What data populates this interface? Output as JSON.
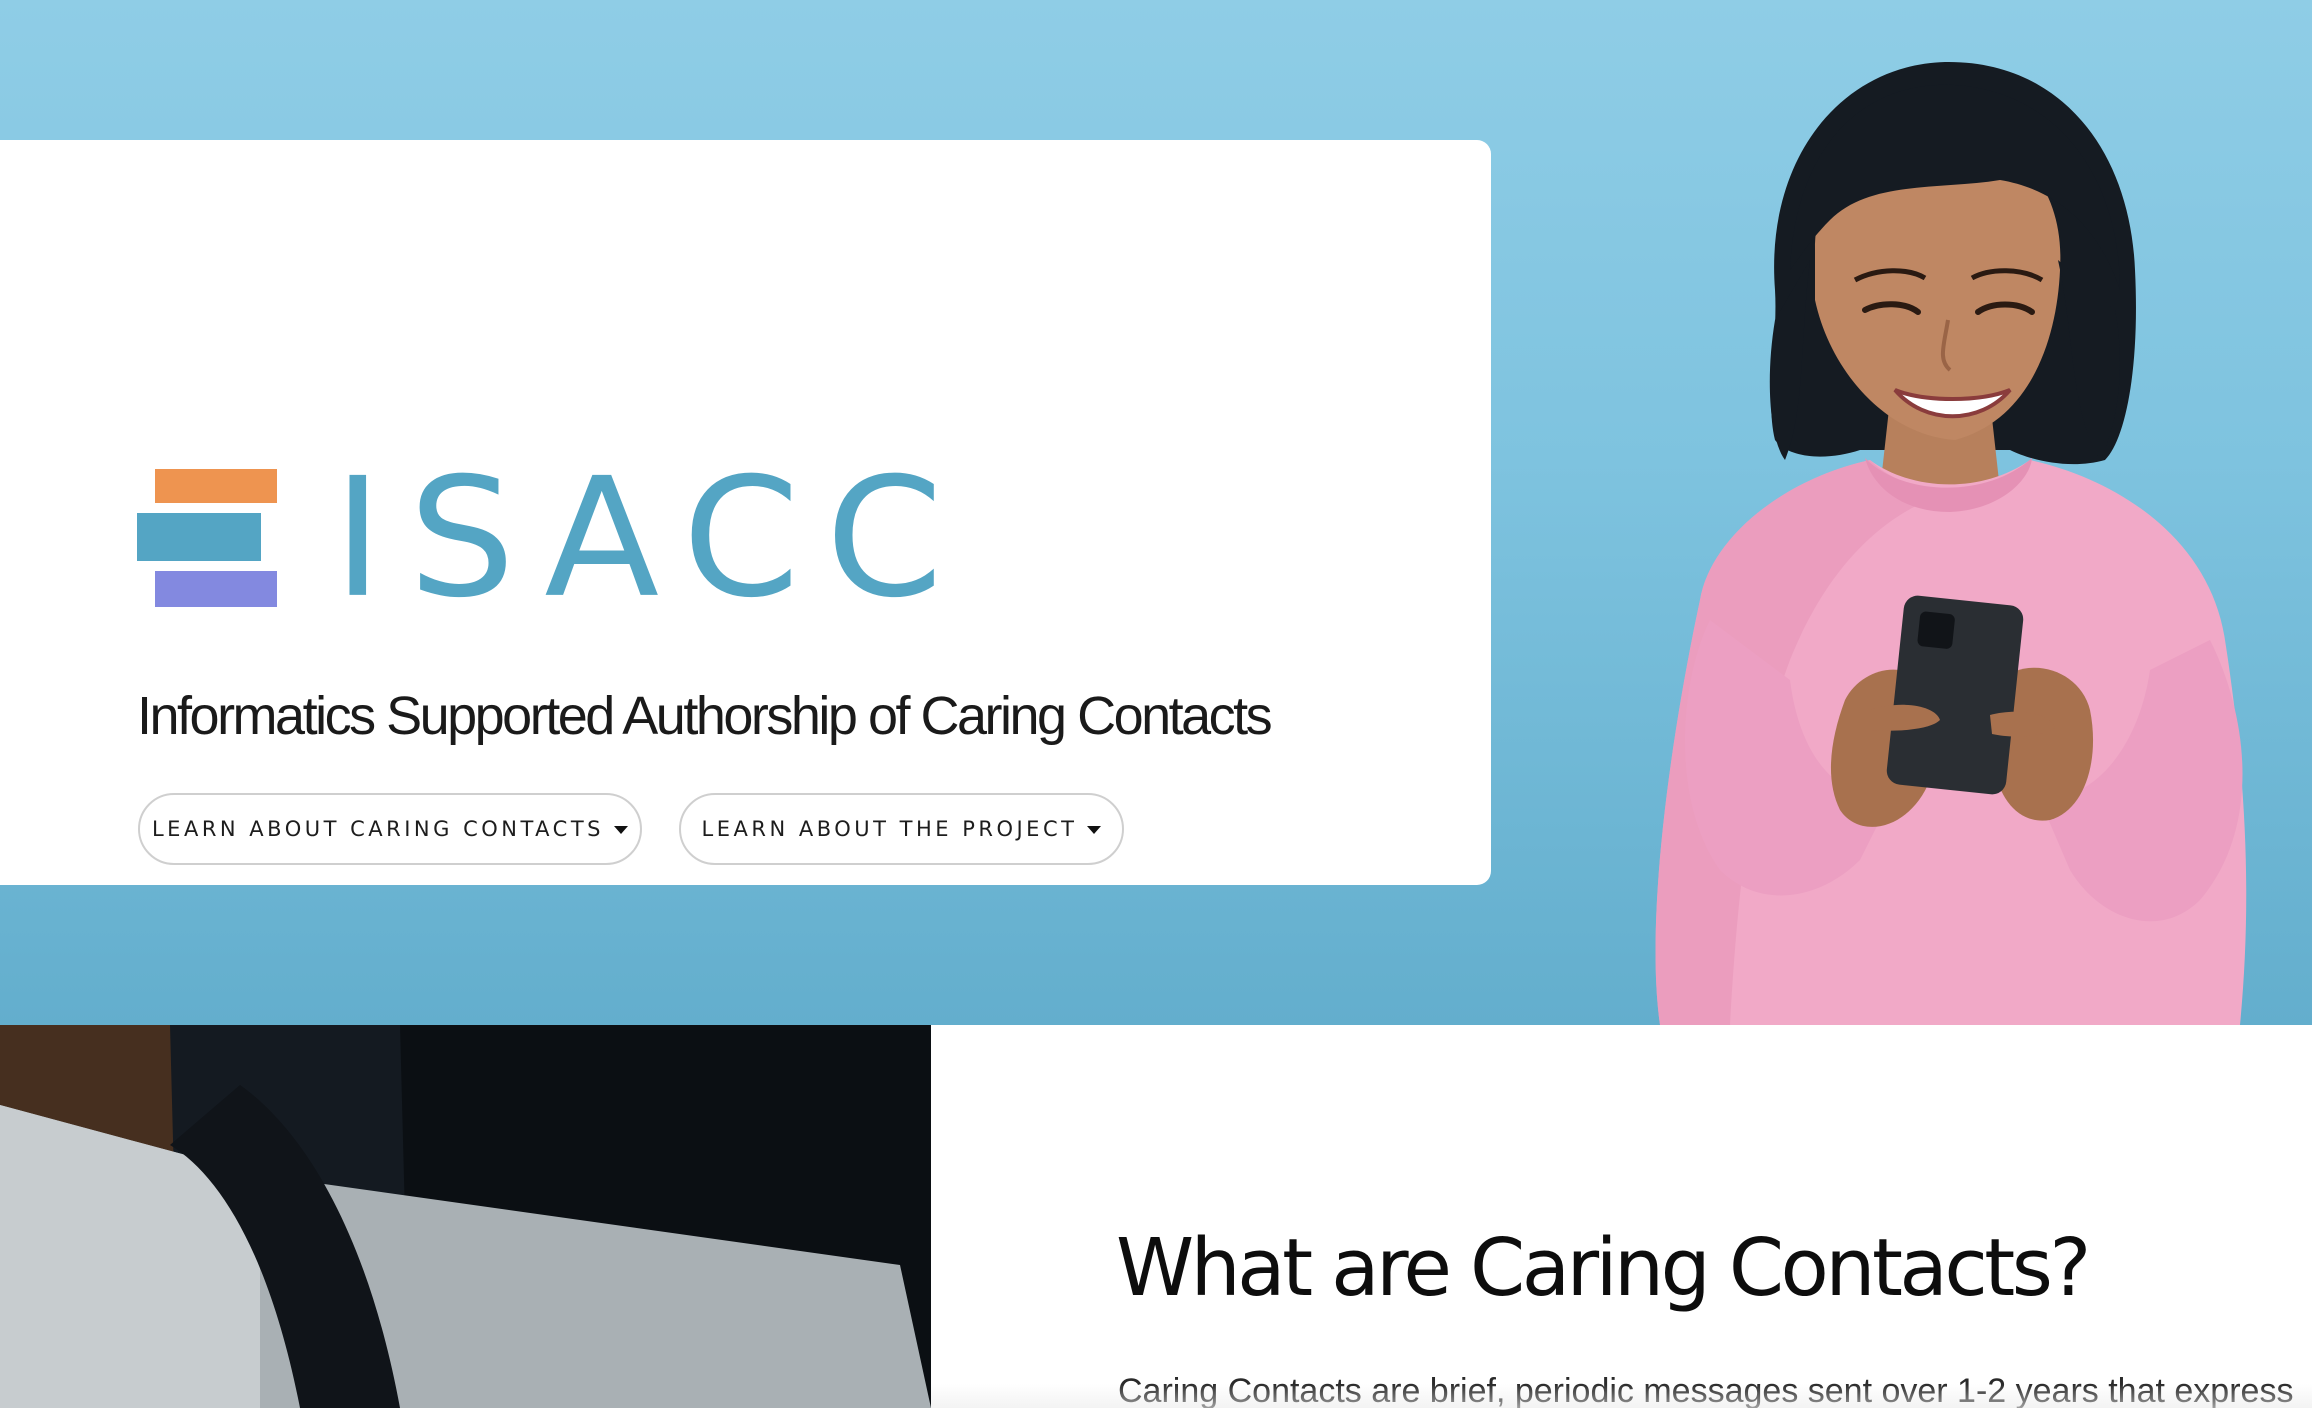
{
  "colors": {
    "hero_bg": "#86c8e2",
    "logo_orange": "#ee9450",
    "logo_teal": "#54a5c4",
    "logo_purple": "#8389e0",
    "logo_text": "#54a5c4",
    "sweater_pink": "#f1a9c7"
  },
  "hero": {
    "logo": {
      "icon": "stacked-bars-logo-icon",
      "text": "ISACC"
    },
    "tagline": "Informatics Supported Authorship of Caring Contacts",
    "buttons": [
      {
        "label": "LEARN ABOUT CARING CONTACTS",
        "icon": "caret-down-icon"
      },
      {
        "label": "LEARN ABOUT THE PROJECT",
        "icon": "caret-down-icon"
      }
    ]
  },
  "section": {
    "title": "What are Caring Contacts?",
    "body": "Caring Contacts are brief, periodic messages sent over 1-2 years that express"
  }
}
